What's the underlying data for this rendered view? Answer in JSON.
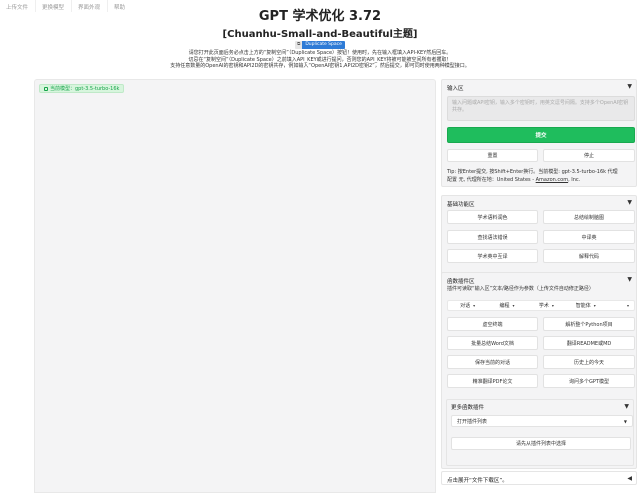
{
  "menubar": [
    "上传文件",
    "更换模型",
    "界面外观",
    "帮助"
  ],
  "header": {
    "title": "GPT 学术优化 3.72",
    "subtitle": "[Chuanhu-Small-and-Beautiful主题]",
    "duplicate_badge_left": "⧉",
    "duplicate_badge_right": "Duplicate Space",
    "description_lines": [
      "请您打开此页面后务必点击上方的“复制空间”（Duplicate Space）按钮！使用时，先在输入框填入API-KEY然后回车。",
      "切忌在“复制空间”（Duplicate Space）之前填入API_KEY或进行提问，否则您的API_KEY将被可能被空间所有者攫取！",
      "支持任意数量的OpenAI的密钥和API2D的密钥共存，例如输入“OpenAI密钥1,API2D密钥2”，然后提交，即可同时使用两种模型接口。"
    ]
  },
  "chat": {
    "model_label": "当前模型：gpt-3.5-turbo-16k"
  },
  "input_panel": {
    "title": "输入区",
    "caret": "▼",
    "placeholder": "输入问题或API密钥，输入多个密钥时，用英文逗号间隔。支持多个OpenAI密钥共存。",
    "submit": "提交",
    "reset": "重置",
    "stop": "停止",
    "tip_line1": "Tip: 按Enter提交, 按Shift+Enter换行。当前模型: gpt-3.5-turbo-16k 代理",
    "tip_line2_prefix": "配置 无, 代理所在地：United States - ",
    "tip_link": "Amazon.com",
    "tip_line2_suffix": ", Inc."
  },
  "basic_panel": {
    "title": "基础功能区",
    "caret": "▼",
    "buttons": [
      "学术语料润色",
      "总结绘制脑图",
      "查找语法错误",
      "中译英",
      "学术英中互译",
      "解释代码"
    ]
  },
  "plugin_panel": {
    "title": "函数插件区",
    "caret": "▼",
    "description": "插件可读取“输入区”文本/路径作为参数（上传文件自动修正路径）",
    "filters": [
      "对话",
      "编程",
      "学术",
      "智能体",
      ""
    ],
    "filter_arrow": "▾",
    "buttons": [
      "虚空终端",
      "解析整个Python项目",
      "批量总结Word文档",
      "翻译README或MD",
      "保存当前的对话",
      "历史上的今天",
      "精准翻译PDF论文",
      "询问多个GPT模型"
    ],
    "more_title": "更多函数插件",
    "more_caret": "▼",
    "select_value": "打开插件列表",
    "select_arrow": "▼",
    "choose_button": "请先从插件列表中选择"
  },
  "download_panel": {
    "title": "点击展开“文件下载区”。",
    "caret": "◀"
  }
}
